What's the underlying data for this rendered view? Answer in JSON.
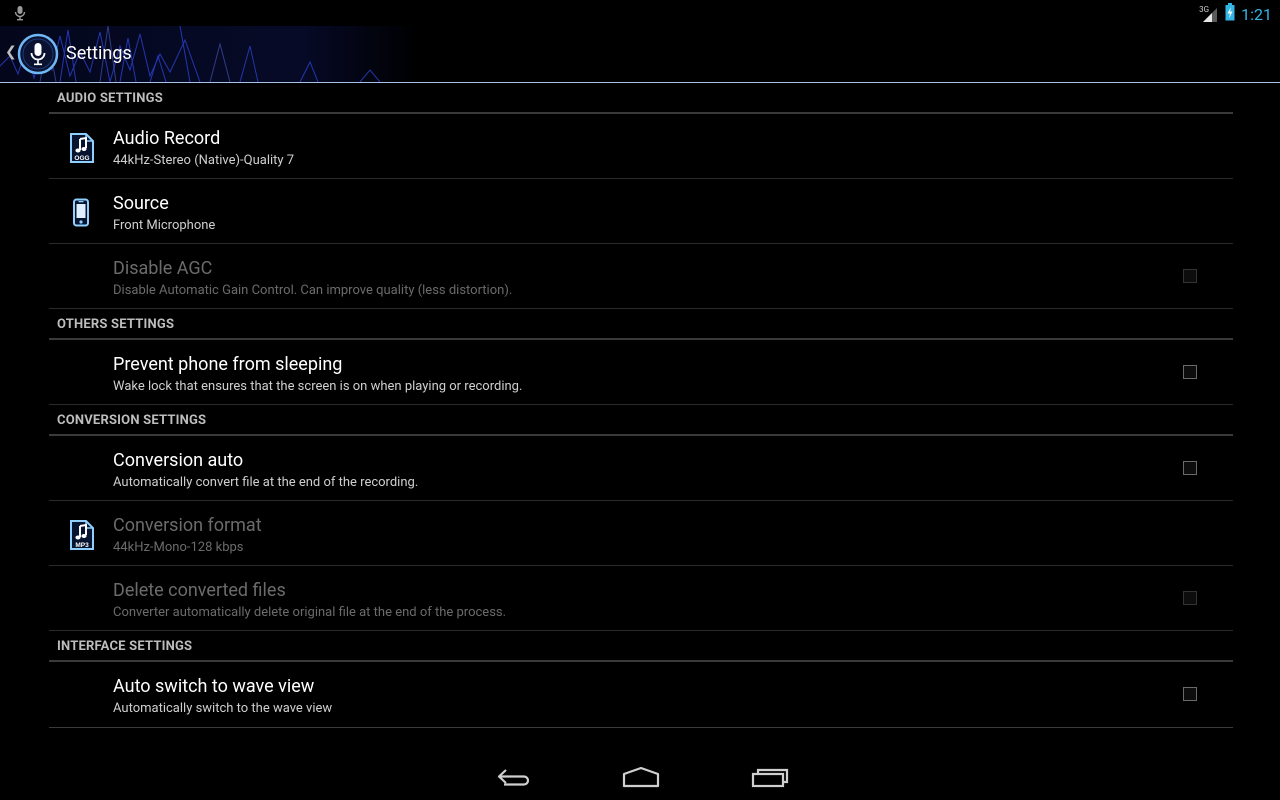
{
  "status_bar": {
    "network": "3G",
    "clock": "1:21",
    "icons": [
      "mic-notification-icon",
      "signal-icon",
      "battery-charging-icon"
    ],
    "accent": "#33b5e5"
  },
  "action_bar": {
    "title": "Settings",
    "icons": [
      "back-caret-icon",
      "app-mic-icon"
    ]
  },
  "sections": [
    {
      "header": "AUDIO SETTINGS",
      "items": [
        {
          "title": "Audio Record",
          "summary": "44kHz-Stereo (Native)-Quality 7",
          "icon": "ogg-file-icon",
          "icon_label": "OGG",
          "enabled": true
        },
        {
          "title": "Source",
          "summary": "Front Microphone",
          "icon": "phone-icon",
          "enabled": true
        },
        {
          "title": "Disable AGC",
          "summary": "Disable Automatic Gain Control. Can improve quality (less distortion).",
          "checkbox": false,
          "enabled": false
        }
      ]
    },
    {
      "header": "OTHERS SETTINGS",
      "items": [
        {
          "title": "Prevent phone from sleeping",
          "summary": "Wake lock that ensures that the screen is on when playing or recording.",
          "checkbox": false,
          "enabled": true
        }
      ]
    },
    {
      "header": "CONVERSION SETTINGS",
      "items": [
        {
          "title": "Conversion auto",
          "summary": "Automatically convert file at the end of the recording.",
          "checkbox": false,
          "enabled": true
        },
        {
          "title": "Conversion format",
          "summary": "44kHz-Mono-128 kbps",
          "icon": "mp3-file-icon",
          "icon_label": "MP3",
          "enabled": false
        },
        {
          "title": "Delete converted files",
          "summary": "Converter automatically delete original file at the end of the process.",
          "checkbox": false,
          "enabled": false
        }
      ]
    },
    {
      "header": "INTERFACE SETTINGS",
      "items": [
        {
          "title": "Auto switch to wave view",
          "summary": "Automatically switch to the wave view",
          "checkbox": false,
          "enabled": true
        }
      ]
    }
  ],
  "nav_bar": {
    "buttons": [
      "back-icon",
      "home-icon",
      "recent-apps-icon"
    ]
  }
}
